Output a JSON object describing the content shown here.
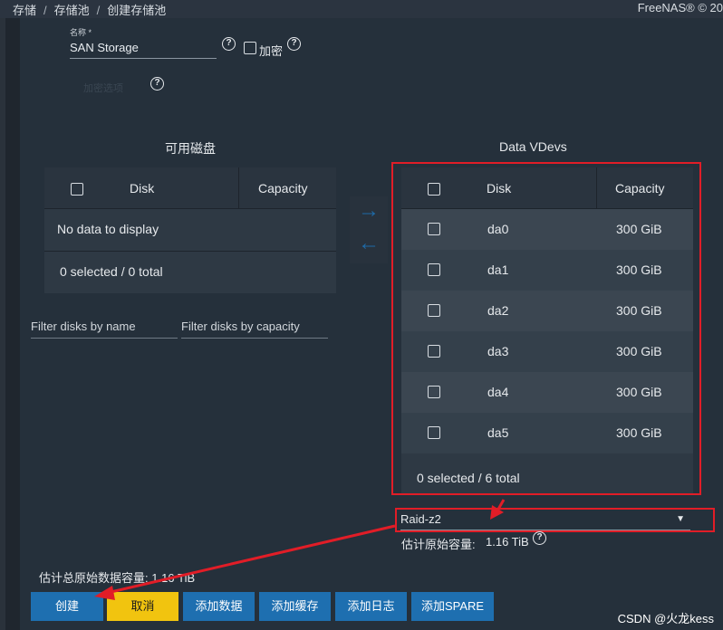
{
  "breadcrumb": {
    "items": [
      "存储",
      "存储池",
      "创建存储池"
    ],
    "separator": "/"
  },
  "brand": "FreeNAS® © 20",
  "form": {
    "name_label": "名称 *",
    "name_value": "SAN Storage",
    "encrypt_label": "加密",
    "blurred_text": "加密选项"
  },
  "available": {
    "title": "可用磁盘",
    "columns": [
      "Disk",
      "Capacity"
    ],
    "empty_text": "No data to display",
    "footer": "0 selected / 0 total"
  },
  "transfer": {
    "right_arrow": "→",
    "left_arrow": "←"
  },
  "filters": {
    "name_placeholder": "Filter disks by name",
    "capacity_placeholder": "Filter disks by capacity"
  },
  "vdevs": {
    "title": "Data VDevs",
    "columns": [
      "Disk",
      "Capacity"
    ],
    "rows": [
      {
        "disk": "da0",
        "capacity": "300 GiB"
      },
      {
        "disk": "da1",
        "capacity": "300 GiB"
      },
      {
        "disk": "da2",
        "capacity": "300 GiB"
      },
      {
        "disk": "da3",
        "capacity": "300 GiB"
      },
      {
        "disk": "da4",
        "capacity": "300 GiB"
      },
      {
        "disk": "da5",
        "capacity": "300 GiB"
      }
    ],
    "footer": "0 selected / 6 total"
  },
  "layout_select": {
    "value": "Raid-z2"
  },
  "estimate": {
    "label": "估计原始容量:",
    "value": "1.16 TiB"
  },
  "total_estimate": {
    "text": "估计总原始数据容量: 1.16 TiB"
  },
  "buttons": {
    "create": "创建",
    "cancel": "取消",
    "add_data": "添加数据",
    "add_cache": "添加缓存",
    "add_log": "添加日志",
    "add_spare": "添加SPARE"
  },
  "watermark": "CSDN @火龙kess",
  "colors": {
    "background": "#222a33",
    "panel": "#25303b",
    "accent_blue": "#1e6fb0",
    "cancel_yellow": "#f1c40f",
    "annotation_red": "#e11d27"
  }
}
